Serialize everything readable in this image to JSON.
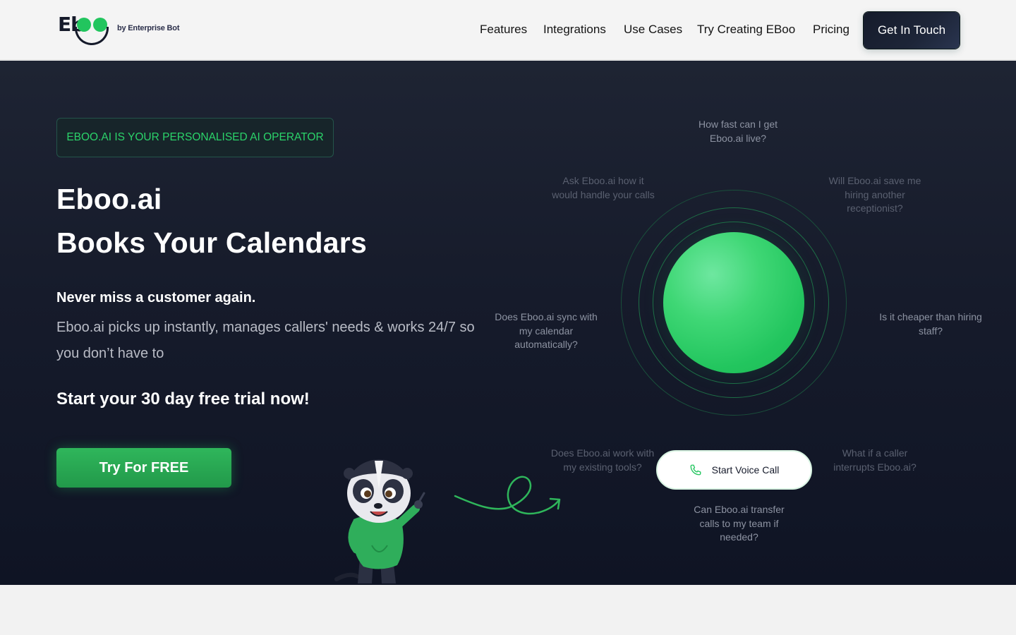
{
  "header": {
    "logo_text": "Eb",
    "logo_by": "by Enterprise Bot",
    "nav": [
      "Features",
      "Integrations",
      "Use Cases",
      "Try Creating EBoo",
      "Pricing"
    ],
    "cta_label": "Get In Touch"
  },
  "hero": {
    "badge": "EBOO.AI IS YOUR PERSONALISED AI OPERATOR",
    "title_line1": "Eboo.ai",
    "title_line2": "Books Your Calendars",
    "lead": "Never miss a customer again.",
    "description": "Eboo.ai picks up instantly, manages callers' needs & works 24/7 so you don’t have to",
    "trial": "Start your 30 day free trial now!",
    "try_button": "Try For FREE"
  },
  "questions": [
    "How fast can I get Eboo.ai live?",
    "Ask Eboo.ai how it would handle your calls",
    "Will Eboo.ai save me hiring another receptionist?",
    "Does Eboo.ai sync with my calendar automatically?",
    "Is it cheaper than hiring staff?",
    "Does Eboo.ai work with my existing tools?",
    "What if a caller interrupts Eboo.ai?",
    "Can Eboo.ai transfer calls to my team if needed?"
  ],
  "voice_call": {
    "label": "Start Voice Call",
    "icon": "phone-icon"
  },
  "colors": {
    "accent": "#22c55e",
    "dark": "#151a2a"
  }
}
